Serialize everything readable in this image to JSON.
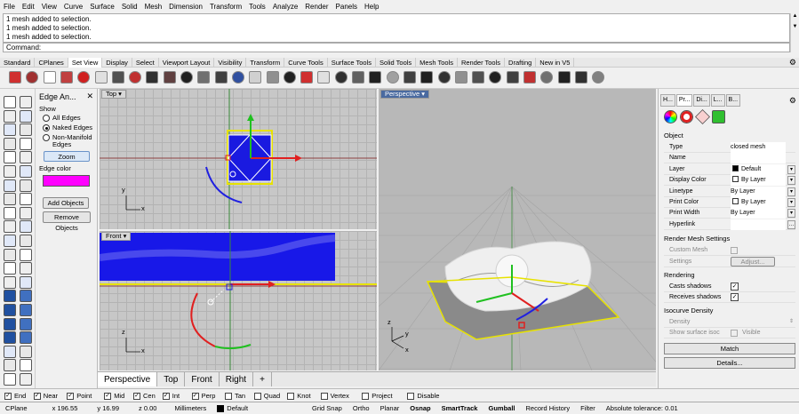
{
  "menu": [
    "File",
    "Edit",
    "View",
    "Curve",
    "Surface",
    "Solid",
    "Mesh",
    "Dimension",
    "Transform",
    "Tools",
    "Analyze",
    "Render",
    "Panels",
    "Help"
  ],
  "command_history": [
    "1 mesh added to selection.",
    "1 mesh added to selection.",
    "1 mesh added to selection."
  ],
  "command_prompt": "Command:",
  "toolbar_tabs": [
    "Standard",
    "CPlanes",
    "Set View",
    "Display",
    "Select",
    "Viewport Layout",
    "Visibility",
    "Transform",
    "Curve Tools",
    "Surface Tools",
    "Solid Tools",
    "Mesh Tools",
    "Render Tools",
    "Drafting",
    "New in V5"
  ],
  "active_toolbar_tab": "Set View",
  "edge_panel": {
    "title": "Edge An...",
    "show_label": "Show",
    "options": [
      "All Edges",
      "Naked Edges",
      "Non-Manifold Edges"
    ],
    "selected_option": "Naked Edges",
    "zoom_button": "Zoom",
    "edge_color_label": "Edge color",
    "edge_color": "#ff00ff",
    "add_objects": "Add Objects",
    "remove_objects": "Remove Objects"
  },
  "viewports": {
    "top": {
      "title": "Top",
      "axis_y": "y",
      "axis_x": "x"
    },
    "front": {
      "title": "Front",
      "axis_z": "z",
      "axis_x": "x"
    },
    "perspective": {
      "title": "Perspective",
      "axis_z": "z",
      "axis_y": "y",
      "axis_x": "x"
    }
  },
  "viewport_tabs": [
    "Perspective",
    "Top",
    "Front",
    "Right",
    "+"
  ],
  "active_viewport_tab": "Perspective",
  "properties": {
    "tabs": [
      "H...",
      "Pr...",
      "Di...",
      "L...",
      "B..."
    ],
    "object_section": "Object",
    "rows": [
      {
        "key": "Type",
        "value": "closed mesh",
        "dropdown": false
      },
      {
        "key": "Name",
        "value": "",
        "dropdown": false
      },
      {
        "key": "Layer",
        "value": "Default",
        "dropdown": true,
        "swatch": "#000000"
      },
      {
        "key": "Display Color",
        "value": "By Layer",
        "dropdown": true,
        "swatch": "#ffffff"
      },
      {
        "key": "Linetype",
        "value": "By Layer",
        "dropdown": true
      },
      {
        "key": "Print Color",
        "value": "By Layer",
        "dropdown": true,
        "swatch": "#ffffff"
      },
      {
        "key": "Print Width",
        "value": "By Layer",
        "dropdown": true
      },
      {
        "key": "Hyperlink",
        "value": "",
        "dropdown": true
      }
    ],
    "render_mesh_section": "Render Mesh Settings",
    "custom_mesh_label": "Custom Mesh",
    "settings_label": "Settings",
    "adjust_button": "Adjust...",
    "rendering_section": "Rendering",
    "casts_shadows": "Casts shadows",
    "receives_shadows": "Receives shadows",
    "isocurve_section": "Isocurve Density",
    "density_label": "Density",
    "show_isoc_label": "Show surface isoc",
    "visible_label": "Visible",
    "match_button": "Match",
    "details_button": "Details..."
  },
  "osnaps": [
    {
      "label": "End",
      "checked": true
    },
    {
      "label": "Near",
      "checked": true
    },
    {
      "label": "Point",
      "checked": true
    },
    {
      "label": "Mid",
      "checked": true
    },
    {
      "label": "Cen",
      "checked": true
    },
    {
      "label": "Int",
      "checked": true
    },
    {
      "label": "Perp",
      "checked": true
    },
    {
      "label": "Tan",
      "checked": false
    },
    {
      "label": "Quad",
      "checked": false
    },
    {
      "label": "Knot",
      "checked": false
    },
    {
      "label": "Vertex",
      "checked": false
    },
    {
      "label": "Project",
      "checked": false
    },
    {
      "label": "Disable",
      "checked": false
    }
  ],
  "status": {
    "cplane": "CPlane",
    "x": "x 196.55",
    "y": "y 16.99",
    "z": "z 0.00",
    "units": "Millimeters",
    "layer": "Default",
    "grid_snap": "Grid Snap",
    "ortho": "Ortho",
    "planar": "Planar",
    "osnap": "Osnap",
    "smarttrack": "SmartTrack",
    "gumball": "Gumball",
    "record_history": "Record History",
    "filter": "Filter",
    "tolerance": "Absolute tolerance: 0.01"
  }
}
